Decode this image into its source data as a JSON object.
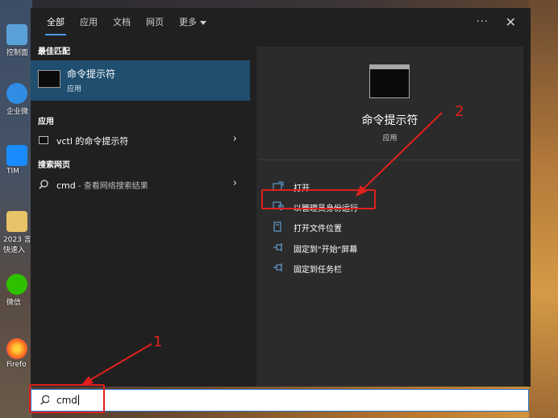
{
  "desktop": {
    "icons": [
      {
        "label": "控制面"
      },
      {
        "label": "企业微"
      },
      {
        "label": "TIM"
      },
      {
        "label": "2023 言 快速入"
      },
      {
        "label": "微信"
      },
      {
        "label": "Firefo"
      }
    ]
  },
  "tabs": [
    {
      "label": "全部"
    },
    {
      "label": "应用"
    },
    {
      "label": "文档"
    },
    {
      "label": "网页"
    },
    {
      "label": "更多"
    }
  ],
  "top_actions": {
    "more": "···",
    "close": "✕"
  },
  "left": {
    "best_match_header": "最佳匹配",
    "best_match": {
      "title": "命令提示符",
      "subtitle": "应用"
    },
    "apps_header": "应用",
    "app_item": "vctl 的命令提示符",
    "web_header": "搜索网页",
    "web_item_query": "cmd",
    "web_item_suffix": " - 查看网络搜索结果"
  },
  "right": {
    "title": "命令提示符",
    "subtitle": "应用",
    "actions": [
      {
        "label": "打开",
        "icon": "open-icon"
      },
      {
        "label": "以管理员身份运行",
        "icon": "shield-icon"
      },
      {
        "label": "打开文件位置",
        "icon": "file-location-icon"
      },
      {
        "label": "固定到\"开始\"屏幕",
        "icon": "pin-icon"
      },
      {
        "label": "固定到任务栏",
        "icon": "pin-icon"
      }
    ]
  },
  "search": {
    "value": "cmd"
  },
  "annotations": {
    "step1": "1",
    "step2": "2",
    "color": "#e0201c"
  }
}
